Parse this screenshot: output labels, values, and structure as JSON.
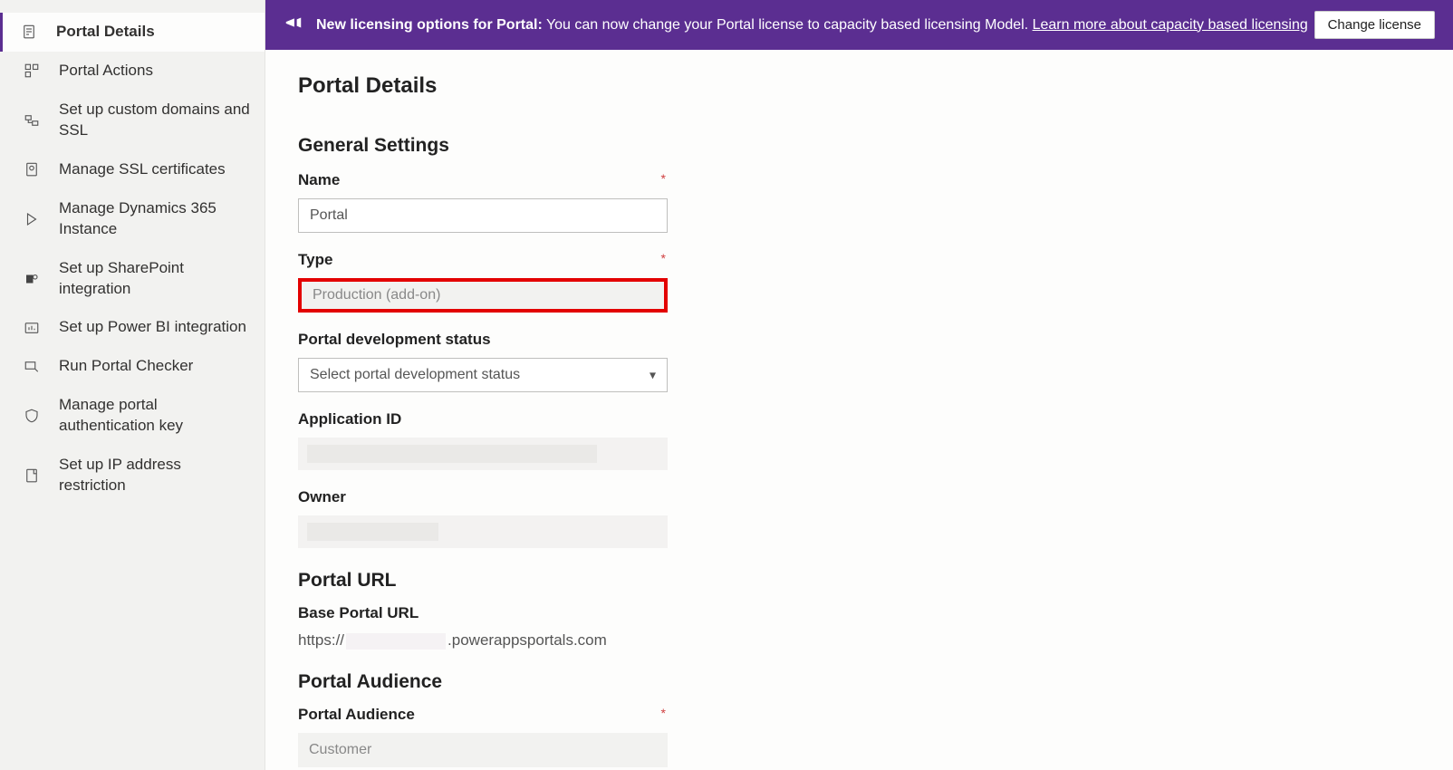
{
  "banner": {
    "title_bold": "New licensing options for Portal:",
    "title_rest": " You can now change your Portal license to capacity based licensing Model. ",
    "link": "Learn more about capacity based licensing",
    "button": "Change license"
  },
  "sidebar": {
    "items": [
      {
        "label": "Portal Details"
      },
      {
        "label": "Portal Actions"
      },
      {
        "label": "Set up custom domains and SSL"
      },
      {
        "label": "Manage SSL certificates"
      },
      {
        "label": "Manage Dynamics 365 Instance"
      },
      {
        "label": "Set up SharePoint integration"
      },
      {
        "label": "Set up Power BI integration"
      },
      {
        "label": "Run Portal Checker"
      },
      {
        "label": "Manage portal authentication key"
      },
      {
        "label": "Set up IP address restriction"
      }
    ]
  },
  "page": {
    "title": "Portal Details",
    "general_settings_heading": "General Settings",
    "name_label": "Name",
    "name_value": "Portal",
    "type_label": "Type",
    "type_value": "Production (add-on)",
    "dev_status_label": "Portal development status",
    "dev_status_placeholder": "Select portal development status",
    "app_id_label": "Application ID",
    "owner_label": "Owner",
    "portal_url_heading": "Portal URL",
    "base_url_label": "Base Portal URL",
    "base_url_prefix": "https://",
    "base_url_suffix": ".powerappsportals.com",
    "audience_heading": "Portal Audience",
    "audience_label": "Portal Audience",
    "audience_value": "Customer",
    "required_marker": "*"
  }
}
